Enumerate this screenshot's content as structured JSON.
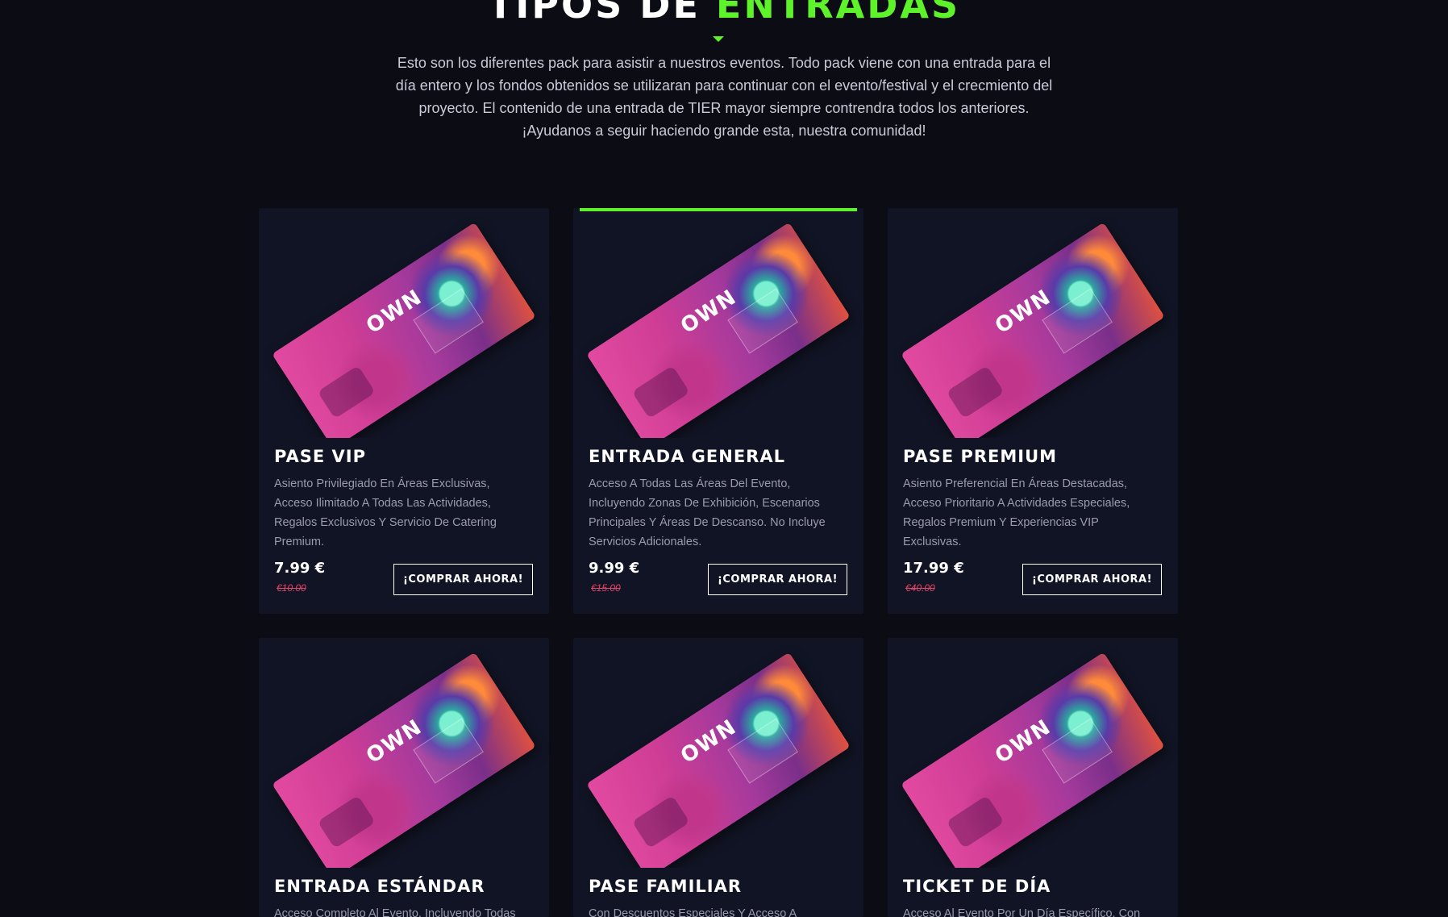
{
  "section": {
    "title_white": "TIPOS DE",
    "title_green": "ENTRADAS",
    "intro": "Esto son los diferentes pack para asistir a nuestros eventos. Todo pack viene con una entrada para el día entero y los fondos obtenidos se utilizaran para continuar con el evento/festival y el crecmiento del proyecto. El contenido de una entrada de TIER mayor siempre contrendra todos los anteriores. ¡Ayudanos a seguir haciendo grande esta, nuestra comunidad!"
  },
  "colors": {
    "background": "#0c0d14",
    "card": "#111424",
    "accent": "#5ef22a",
    "old_price": "#e0456a"
  },
  "ticket_image": {
    "logo": "OWN",
    "icon": "ticket-image"
  },
  "cards": [
    {
      "name": "PASE VIP",
      "description": "Asiento Privilegiado En Áreas Exclusivas, Acceso Ilimitado A Todas Las Actividades, Regalos Exclusivos Y Servicio De Catering Premium.",
      "price": "7.99 €",
      "old_price": "€10.00",
      "button": "¡COMPRAR AHORA!",
      "featured": false
    },
    {
      "name": "ENTRADA GENERAL",
      "description": "Acceso A Todas Las Áreas Del Evento, Incluyendo Zonas De Exhibición, Escenarios Principales Y Áreas De Descanso. No Incluye Servicios Adicionales.",
      "price": "9.99 €",
      "old_price": "€15.00",
      "button": "¡COMPRAR AHORA!",
      "featured": true
    },
    {
      "name": "PASE PREMIUM",
      "description": "Asiento Preferencial En Áreas Destacadas, Acceso Prioritario A Actividades Especiales, Regalos Premium Y Experiencias VIP Exclusivas.",
      "price": "17.99 €",
      "old_price": "€40.00",
      "button": "¡COMPRAR AHORA!",
      "featured": false
    },
    {
      "name": "ENTRADA ESTÁNDAR",
      "description": "Acceso Completo Al Evento, Incluyendo Todas"
    },
    {
      "name": "PASE FAMILIAR",
      "description": "Con Descuentos Especiales Y Acceso A"
    },
    {
      "name": "TICKET DE DÍA",
      "description": "Acceso Al Evento Por Un Día Específico. Con"
    }
  ]
}
